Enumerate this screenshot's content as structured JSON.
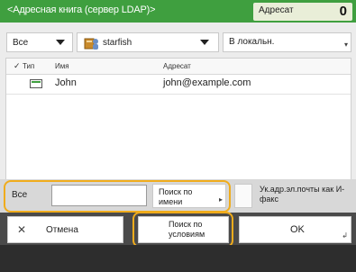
{
  "header": {
    "title": "<Адресная книга (сервер LDAP)>",
    "recipient_label": "Адресат",
    "recipient_count": "0"
  },
  "filters": {
    "category_value": "Все",
    "server_value": "starfish",
    "local_button": "В локальн."
  },
  "table": {
    "headers": {
      "type": "Тип",
      "name": "Имя",
      "address": "Адресат"
    },
    "rows": [
      {
        "name": "John",
        "address": "john@example.com"
      }
    ]
  },
  "search": {
    "all_label": "Все",
    "input_value": "",
    "by_name_label": "Поиск по имени",
    "email_ifax_label": "Ук.адр.эл.почты как И-факс"
  },
  "bottom": {
    "cancel_label": "Отмена",
    "conditions_label": "Поиск по условиям",
    "ok_label": "OK"
  },
  "colors": {
    "header": "#3f9f3f",
    "highlight": "#f0ac1c"
  }
}
